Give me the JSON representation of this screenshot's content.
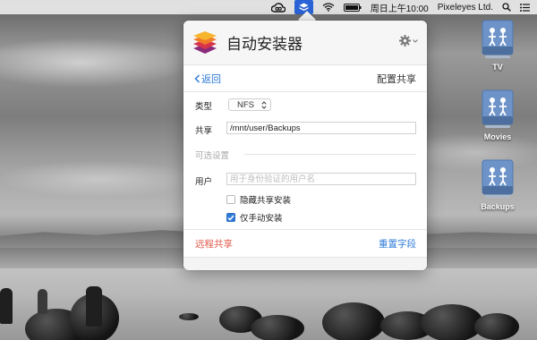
{
  "menubar": {
    "clock": "周日上午10:00",
    "user": "Pixeleyes Ltd.",
    "icons": [
      "creative-cloud-icon",
      "installer-app-icon",
      "wifi-icon",
      "battery-icon",
      "search-icon",
      "notification-list-icon"
    ]
  },
  "desktop": {
    "drives": [
      {
        "label": "TV"
      },
      {
        "label": "Movies"
      },
      {
        "label": "Backups"
      }
    ]
  },
  "popover": {
    "app_title": "自动安装器",
    "back_label": "返回",
    "screen_title": "配置共享",
    "form": {
      "type_label": "类型",
      "type_value": "NFS",
      "share_label": "共享",
      "share_value": "/mnt/user/Backups",
      "optional_section": "可选设置",
      "user_label": "用户",
      "user_placeholder": "用于身份验证的用户名",
      "hide_share_label": "隐藏共享安装",
      "hide_share_checked": false,
      "manual_only_label": "仅手动安装",
      "manual_only_checked": true
    },
    "footer": {
      "remote_share": "远程共享",
      "reset_fields": "重置字段"
    }
  },
  "colors": {
    "accent_blue": "#2f7bd8",
    "destructive_red": "#e2584b",
    "menubar_highlight": "#2b63d6"
  }
}
